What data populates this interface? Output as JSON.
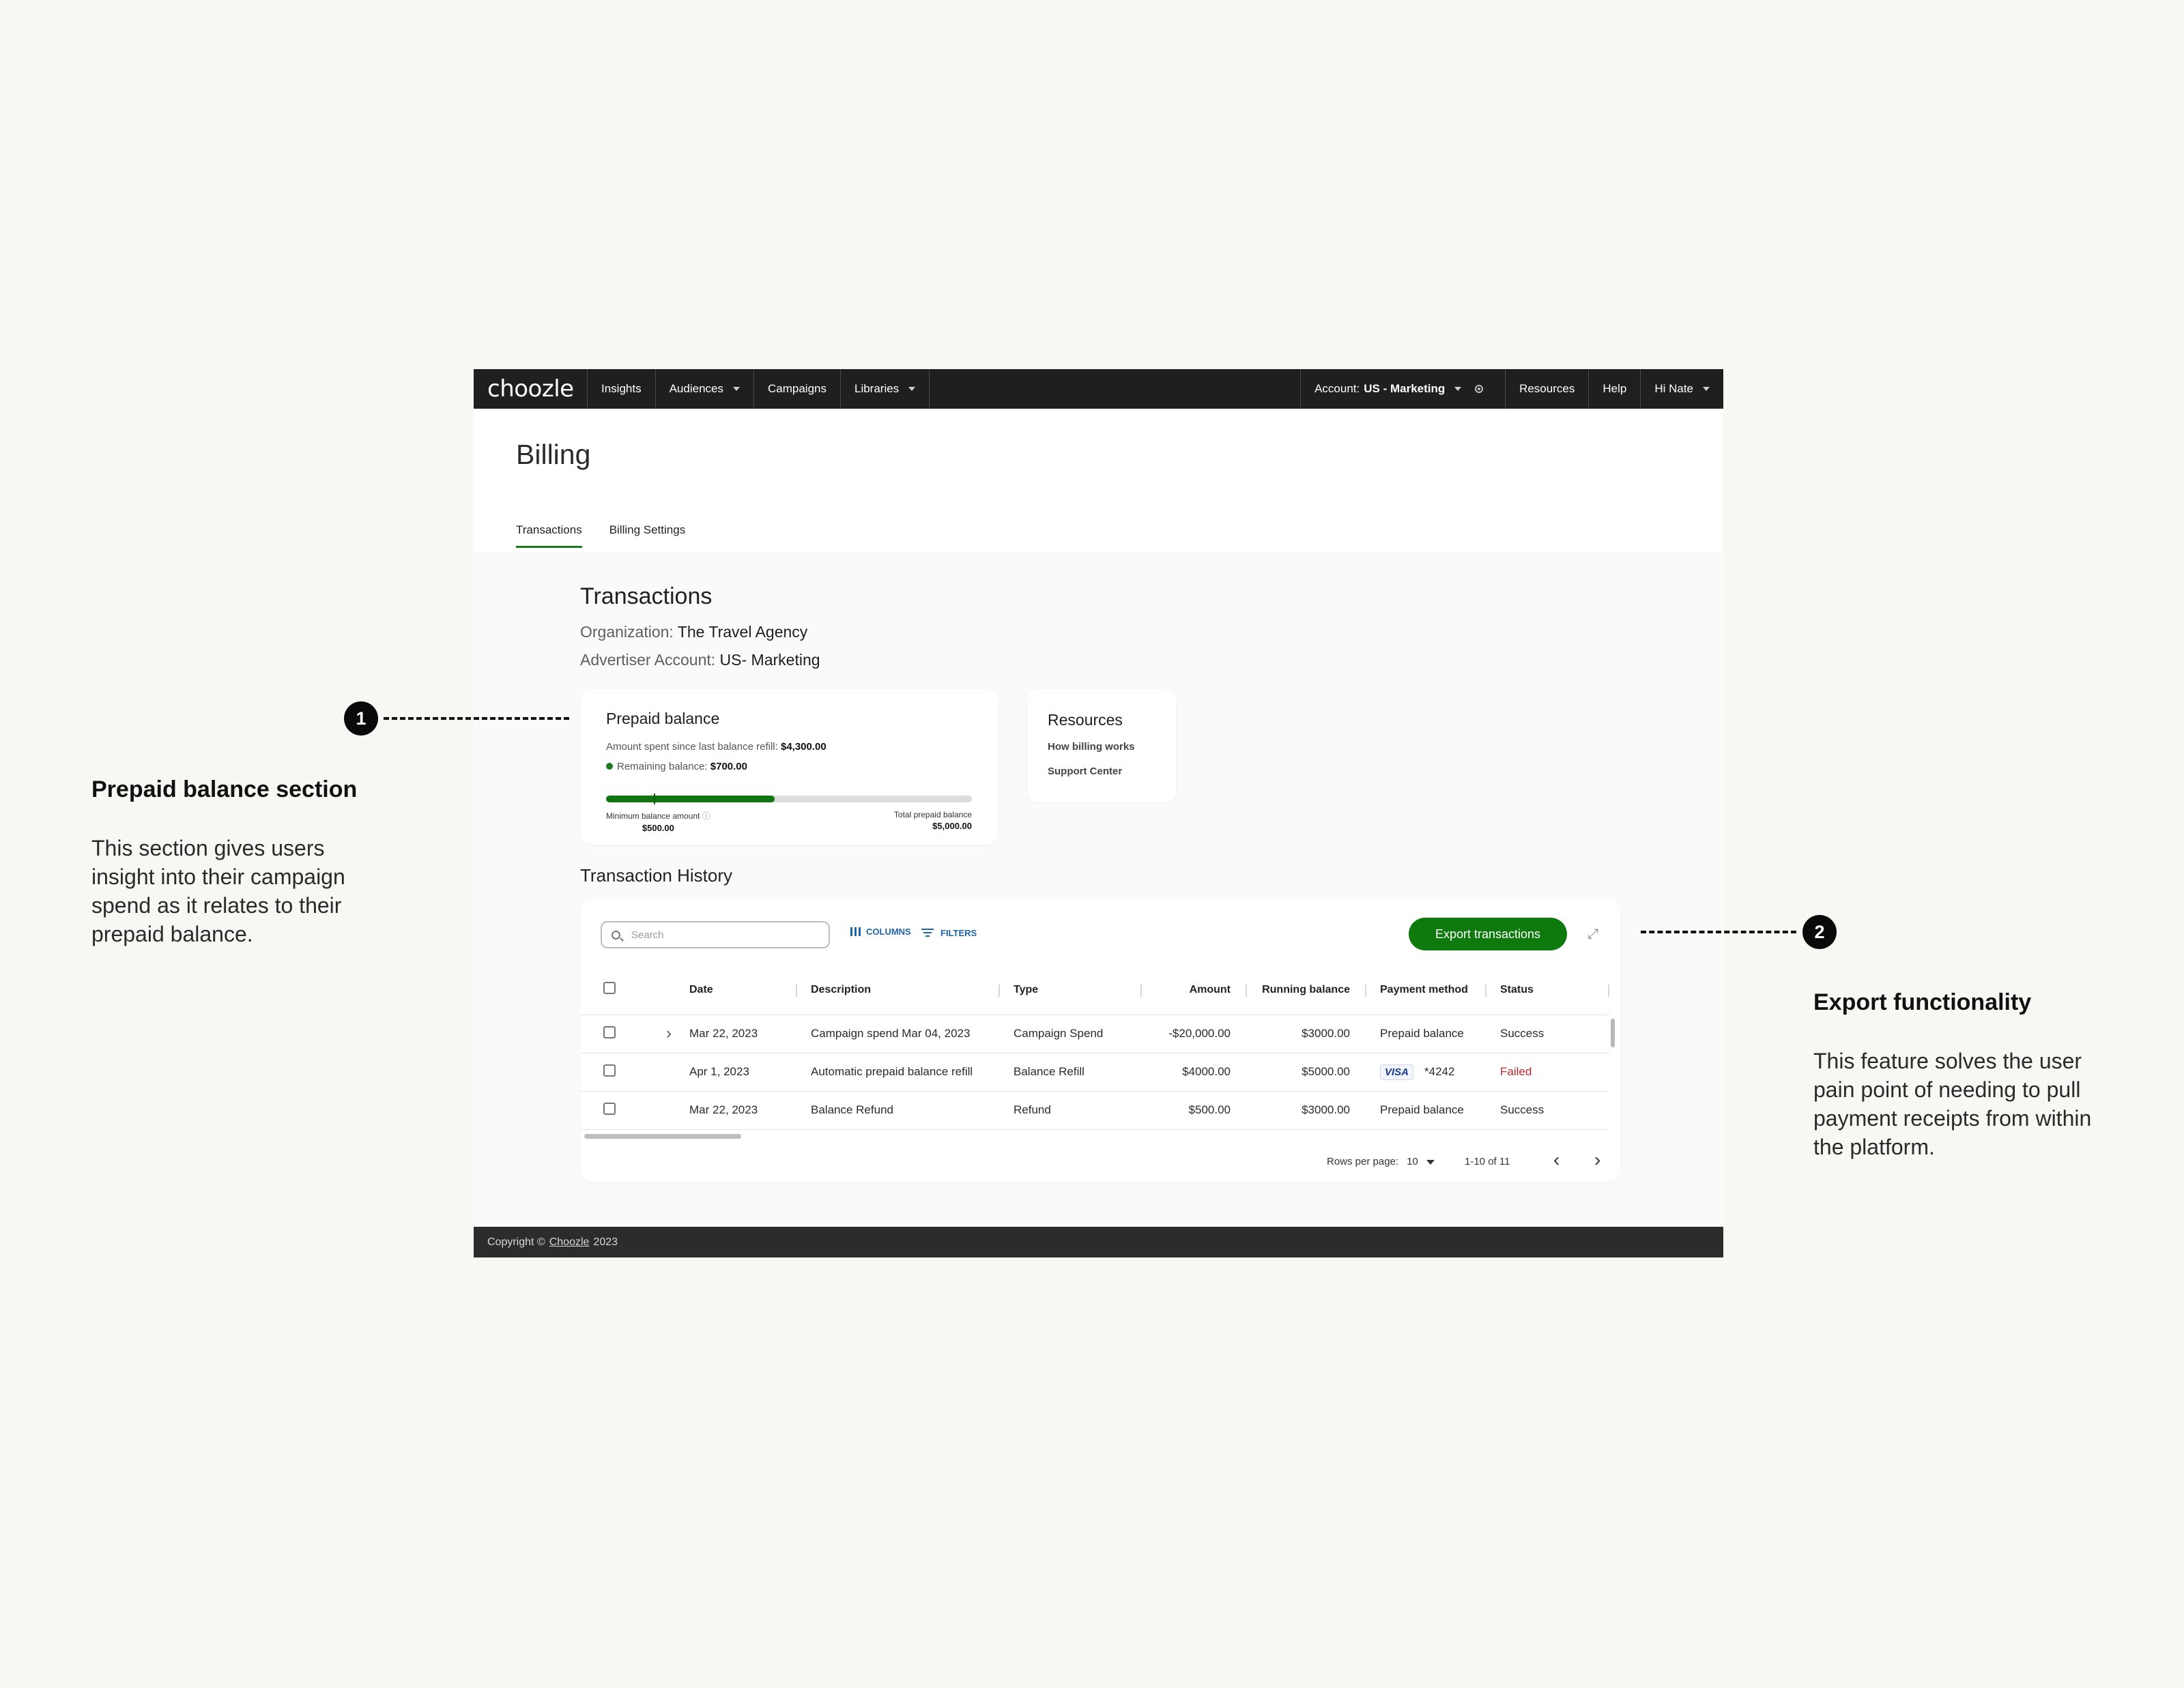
{
  "nav": {
    "logo": "choozle",
    "items": [
      {
        "label": "Insights",
        "caret": false
      },
      {
        "label": "Audiences",
        "caret": true
      },
      {
        "label": "Campaigns",
        "caret": false
      },
      {
        "label": "Libraries",
        "caret": true
      }
    ],
    "account_label": "Account:",
    "account_value": "US - Marketing",
    "resources": "Resources",
    "help": "Help",
    "user": "Hi Nate"
  },
  "page": {
    "title": "Billing",
    "tabs": [
      "Transactions",
      "Billing Settings"
    ],
    "active_tab": "Transactions"
  },
  "transactions": {
    "title": "Transactions",
    "org_label": "Organization:",
    "org_value": "The Travel Agency",
    "adv_label": "Advertiser Account:",
    "adv_value": "US- Marketing"
  },
  "prepaid": {
    "title": "Prepaid balance",
    "spent_label": "Amount spent since last balance refill:",
    "spent_value": "$4,300.00",
    "remaining_label": "Remaining balance:",
    "remaining_value": "$700.00",
    "progress_fraction": 0.46,
    "min_marker_fraction": 0.13,
    "min_label": "Minimum balance amount",
    "min_value": "$500.00",
    "total_label": "Total prepaid balance",
    "total_value": "$5,000.00"
  },
  "resources": {
    "title": "Resources",
    "links": [
      "How billing works",
      "Support Center"
    ]
  },
  "history": {
    "title": "Transaction History",
    "search_placeholder": "Search",
    "columns_label": "COLUMNS",
    "filters_label": "FILTERS",
    "export_label": "Export transactions",
    "headers": [
      "Date",
      "Description",
      "Type",
      "Amount",
      "Running balance",
      "Payment method",
      "Status"
    ],
    "rows": [
      {
        "expand": true,
        "date": "Mar 22, 2023",
        "description": "Campaign spend Mar 04, 2023",
        "type": "Campaign Spend",
        "amount": "-$20,000.00",
        "running": "$3000.00",
        "payment": "Prepaid balance",
        "card": "",
        "status": "Success"
      },
      {
        "expand": false,
        "date": "Apr 1, 2023",
        "description": "Automatic prepaid balance refill",
        "type": "Balance Refill",
        "amount": "$4000.00",
        "running": "$5000.00",
        "payment": "*4242",
        "card": "VISA",
        "status": "Failed"
      },
      {
        "expand": false,
        "date": "Mar 22, 2023",
        "description": "Balance Refund",
        "type": "Refund",
        "amount": "$500.00",
        "running": "$3000.00",
        "payment": "Prepaid balance",
        "card": "",
        "status": "Success"
      }
    ],
    "rows_per_page_label": "Rows per page:",
    "rows_per_page": "10",
    "range": "1-10 of 11"
  },
  "footer": {
    "prefix": "Copyright ©",
    "link": "Choozle",
    "year": "2023"
  },
  "annotations": [
    {
      "num": "1",
      "title": "Prepaid balance section",
      "body": "This section gives users insight into their campaign spend as it relates to their prepaid balance."
    },
    {
      "num": "2",
      "title": "Export functionality",
      "body": "This feature solves the user pain point of needing to pull payment receipts from within the platform."
    }
  ],
  "colors": {
    "accent": "#0e7a0e",
    "failed": "#c4262e",
    "link": "#1f63a8",
    "nav_bg": "#1f1f1f"
  }
}
